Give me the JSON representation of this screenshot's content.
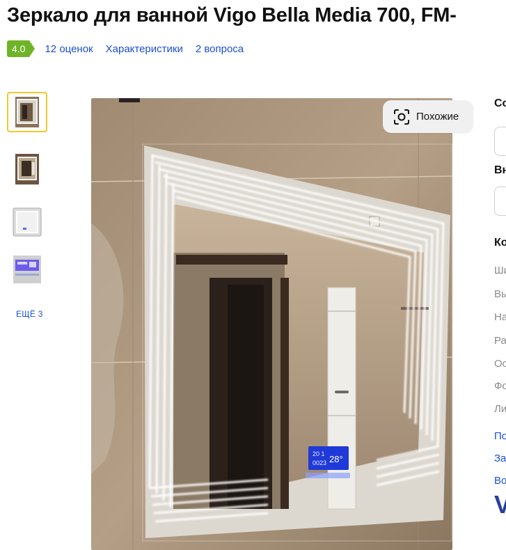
{
  "product": {
    "title": "Зеркало для ванной Vigo Bella Media 700, FM-",
    "rating": "4.0",
    "reviews_link": "12 оценок",
    "specs_link": "Характеристики",
    "questions_link": "2 вопроса"
  },
  "gallery": {
    "more_label": "ЕЩЁ 3",
    "similar_button": "Похожие",
    "thumbnail_count": 4,
    "active_thumbnail": 1
  },
  "side_panel": {
    "heading_1": "Со",
    "heading_2": "Вн",
    "heading_3": "Ко",
    "spec_rows": [
      "Ши",
      "Вы",
      "На",
      "Ра",
      "Ос",
      "Фо",
      "Ли"
    ],
    "links": [
      "По",
      "За",
      "Во"
    ],
    "brand_fragment": "V"
  },
  "mirror_display": {
    "temperature": "28°",
    "clock": "20 1",
    "date": "0023"
  },
  "colors": {
    "link": "#1a4fd1",
    "rating_badge": "#6fb428",
    "active_thumb_border": "#f4c72a",
    "similar_bg": "#f0f0f0"
  },
  "icons": {
    "similar": "lens-scan-icon"
  }
}
